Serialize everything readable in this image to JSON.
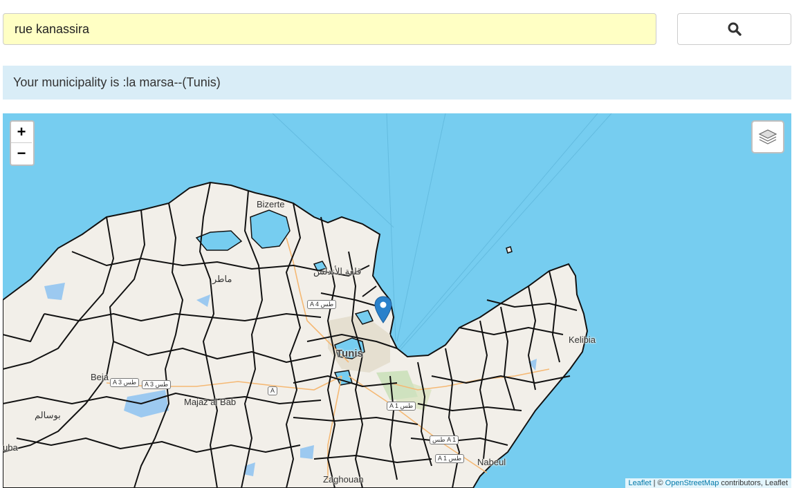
{
  "search": {
    "value": "rue kanassira",
    "button_icon": "search-icon"
  },
  "result": {
    "prefix": "Your municipality is : ",
    "municipality": "la marsa",
    "suffix": " --(Tunis)"
  },
  "map": {
    "zoom_in": "+",
    "zoom_out": "−",
    "layers_icon": "layers-icon",
    "marker_icon": "map-marker-icon",
    "colors": {
      "water": "#76cdf0",
      "land": "#f2efe9",
      "border": "#111111",
      "marker": "#2a81cb"
    },
    "places": {
      "bizerte": "Bizerte",
      "mateur": "ماطر",
      "kalaat": "قلعة الأندلس",
      "tunis": "Tunis",
      "beja": "Beja",
      "majaz": "Majaz al Bab",
      "bousalem": "بوسالم",
      "kelibia": "Kelibia",
      "nabeul": "Nabeul",
      "zaghouan": "Zaghouan",
      "jendouba": "uba"
    },
    "roads": {
      "a4": "A 4 طس",
      "a3_left": "A 3 طس",
      "a3_right": "A 3 طس",
      "a1_center": "A 1 طس",
      "a1_top": "طس A 1",
      "a1_mid": "A 1 طس",
      "a1_bottom": "A 1 طس",
      "a_small": "A"
    },
    "attribution": {
      "leaflet": "Leaflet",
      "sep": " | © ",
      "osm": "OpenStreetMap",
      "rest": " contributors, Leaflet"
    }
  }
}
